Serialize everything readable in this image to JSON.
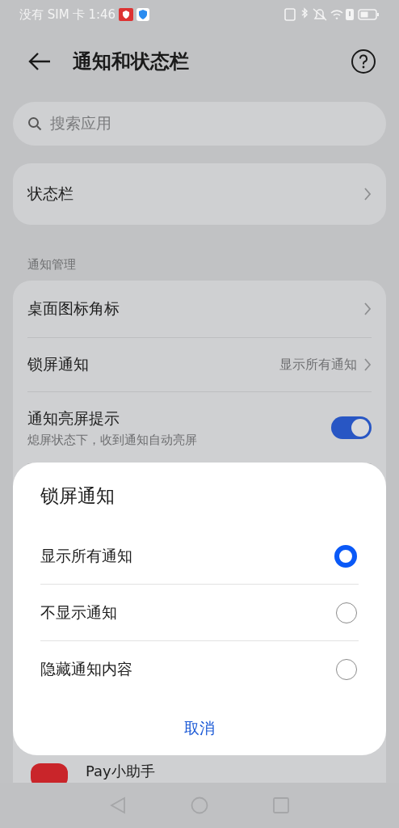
{
  "status_bar": {
    "carrier": "没有 SIM 卡",
    "time": "1:46"
  },
  "header": {
    "title": "通知和状态栏"
  },
  "search": {
    "placeholder": "搜索应用"
  },
  "status_bar_entry": {
    "label": "状态栏"
  },
  "section": {
    "title": "通知管理"
  },
  "settings": [
    {
      "kind": "link",
      "label": "桌面图标角标"
    },
    {
      "kind": "value",
      "label": "锁屏通知",
      "value": "显示所有通知"
    },
    {
      "kind": "toggle",
      "label": "通知亮屏提示",
      "subtitle": "熄屏状态下，收到通知自动亮屏",
      "on": true
    }
  ],
  "app_row": {
    "name": "Pay小助手"
  },
  "dialog": {
    "title": "锁屏通知",
    "options": [
      {
        "label": "显示所有通知",
        "selected": true
      },
      {
        "label": "不显示通知",
        "selected": false
      },
      {
        "label": "隐藏通知内容",
        "selected": false
      }
    ],
    "cancel": "取消"
  }
}
